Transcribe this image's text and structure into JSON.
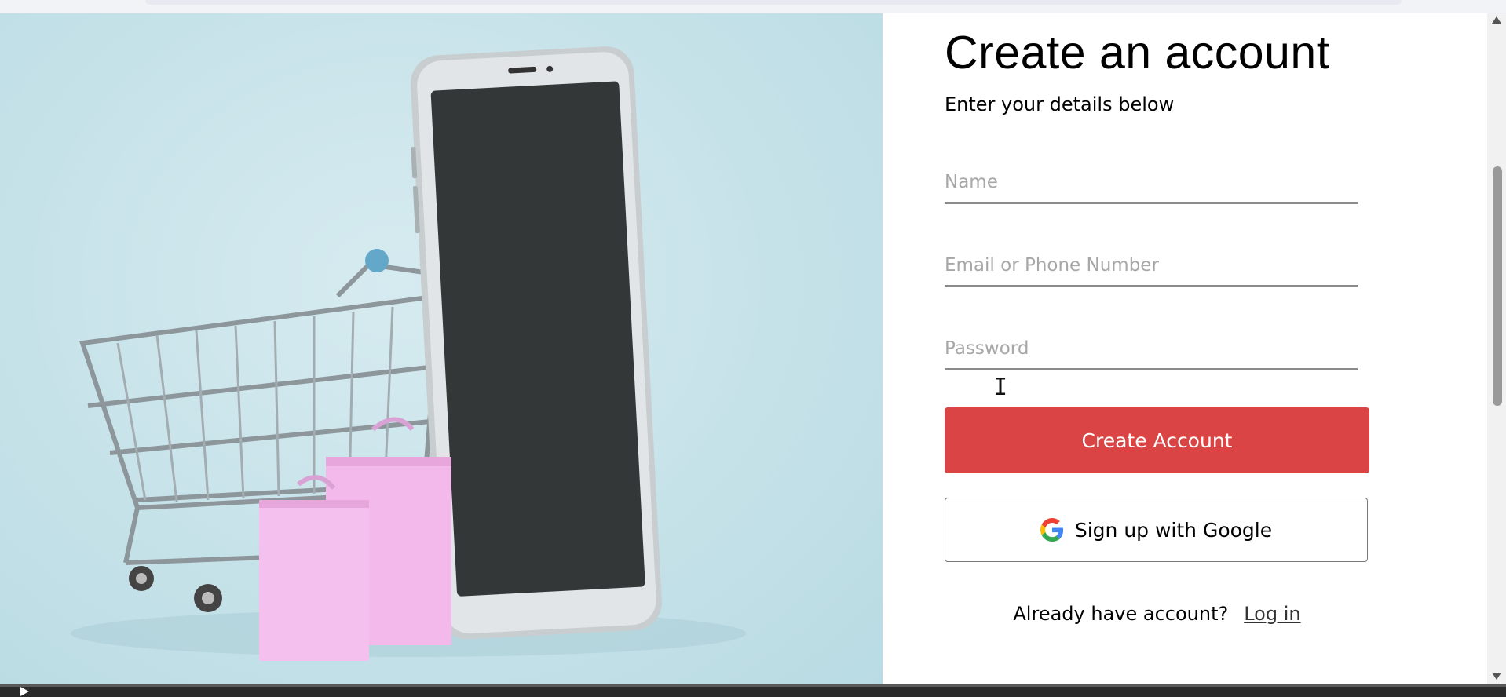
{
  "form": {
    "title": "Create an account",
    "subtitle": "Enter your details below",
    "name_placeholder": "Name",
    "email_placeholder": "Email or Phone Number",
    "password_placeholder": "Password",
    "create_button": "Create Account",
    "google_button": "Sign up with Google",
    "login_prompt": "Already have account?",
    "login_link": "Log in"
  },
  "icons": {
    "google": "google-g-icon",
    "cursor": "text-cursor-icon"
  },
  "colors": {
    "primary": "#db4444",
    "hero_bg": "#c6e2e9"
  }
}
